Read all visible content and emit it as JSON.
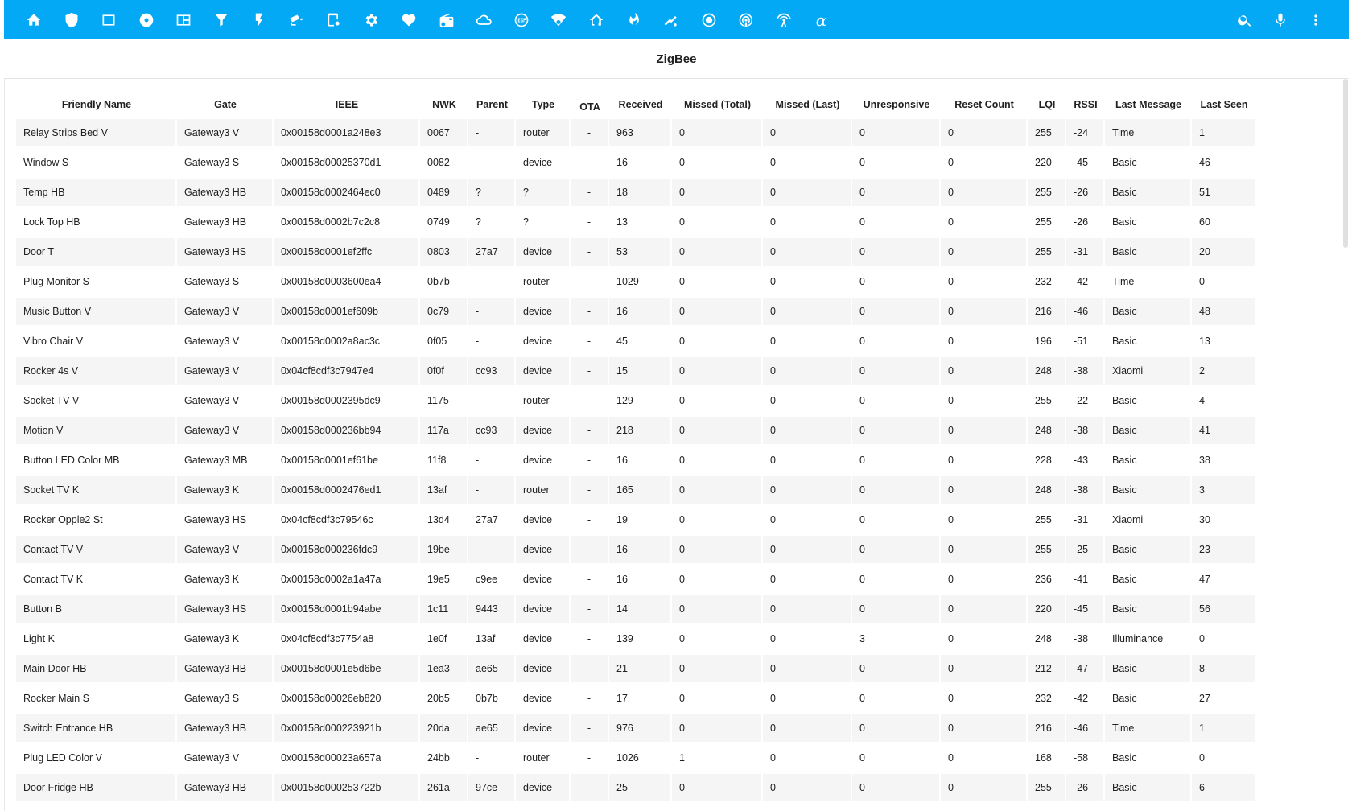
{
  "toolbar": {
    "color": "#03a9f4",
    "left_icons": [
      "home-icon",
      "shield-icon",
      "square-icon",
      "disc-icon",
      "panel-icon",
      "filter-icon",
      "flash-icon",
      "cctv-icon",
      "tablet-cog-icon",
      "gear-icon",
      "heart-pulse-icon",
      "radio-icon",
      "cloud-icon",
      "esp-chip-icon",
      "wifi-cog-icon",
      "home-thermometer-icon",
      "fire-icon",
      "sensor-icon",
      "record-icon",
      "podcast-icon",
      "antenna-icon",
      "alpha-icon"
    ],
    "alpha_glyph": "α",
    "right_icons": [
      "search-icon",
      "microphone-icon",
      "dots-vertical-icon"
    ]
  },
  "page": {
    "title": "ZigBee"
  },
  "table": {
    "columns": [
      "Friendly Name",
      "Gate",
      "IEEE",
      "NWK",
      "Parent",
      "Type",
      "OTA",
      "Received",
      "Missed (Total)",
      "Missed (Last)",
      "Unresponsive",
      "Reset Count",
      "LQI",
      "RSSI",
      "Last Message",
      "Last Seen"
    ],
    "rows": [
      [
        "Relay Strips Bed V",
        "Gateway3 V",
        "0x00158d0001a248e3",
        "0067",
        "-",
        "router",
        "-",
        "963",
        "0",
        "0",
        "0",
        "0",
        "255",
        "-24",
        "Time",
        "1"
      ],
      [
        "Window S",
        "Gateway3 S",
        "0x00158d00025370d1",
        "0082",
        "-",
        "device",
        "-",
        "16",
        "0",
        "0",
        "0",
        "0",
        "220",
        "-45",
        "Basic",
        "46"
      ],
      [
        "Temp HB",
        "Gateway3 HB",
        "0x00158d0002464ec0",
        "0489",
        "?",
        "?",
        "-",
        "18",
        "0",
        "0",
        "0",
        "0",
        "255",
        "-26",
        "Basic",
        "51"
      ],
      [
        "Lock Top HB",
        "Gateway3 HB",
        "0x00158d0002b7c2c8",
        "0749",
        "?",
        "?",
        "-",
        "13",
        "0",
        "0",
        "0",
        "0",
        "255",
        "-26",
        "Basic",
        "60"
      ],
      [
        "Door T",
        "Gateway3 HS",
        "0x00158d0001ef2ffc",
        "0803",
        "27a7",
        "device",
        "-",
        "53",
        "0",
        "0",
        "0",
        "0",
        "255",
        "-31",
        "Basic",
        "20"
      ],
      [
        "Plug Monitor S",
        "Gateway3 S",
        "0x00158d0003600ea4",
        "0b7b",
        "-",
        "router",
        "-",
        "1029",
        "0",
        "0",
        "0",
        "0",
        "232",
        "-42",
        "Time",
        "0"
      ],
      [
        "Music Button V",
        "Gateway3 V",
        "0x00158d0001ef609b",
        "0c79",
        "-",
        "device",
        "-",
        "16",
        "0",
        "0",
        "0",
        "0",
        "216",
        "-46",
        "Basic",
        "48"
      ],
      [
        "Vibro Chair V",
        "Gateway3 V",
        "0x00158d0002a8ac3c",
        "0f05",
        "-",
        "device",
        "-",
        "45",
        "0",
        "0",
        "0",
        "0",
        "196",
        "-51",
        "Basic",
        "13"
      ],
      [
        "Rocker 4s V",
        "Gateway3 V",
        "0x04cf8cdf3c7947e4",
        "0f0f",
        "cc93",
        "device",
        "-",
        "15",
        "0",
        "0",
        "0",
        "0",
        "248",
        "-38",
        "Xiaomi",
        "2"
      ],
      [
        "Socket TV V",
        "Gateway3 V",
        "0x00158d0002395dc9",
        "1175",
        "-",
        "router",
        "-",
        "129",
        "0",
        "0",
        "0",
        "0",
        "255",
        "-22",
        "Basic",
        "4"
      ],
      [
        "Motion V",
        "Gateway3 V",
        "0x00158d000236bb94",
        "117a",
        "cc93",
        "device",
        "-",
        "218",
        "0",
        "0",
        "0",
        "0",
        "248",
        "-38",
        "Basic",
        "41"
      ],
      [
        "Button LED Color MB",
        "Gateway3 MB",
        "0x00158d0001ef61be",
        "11f8",
        "-",
        "device",
        "-",
        "16",
        "0",
        "0",
        "0",
        "0",
        "228",
        "-43",
        "Basic",
        "38"
      ],
      [
        "Socket TV K",
        "Gateway3 K",
        "0x00158d0002476ed1",
        "13af",
        "-",
        "router",
        "-",
        "165",
        "0",
        "0",
        "0",
        "0",
        "248",
        "-38",
        "Basic",
        "3"
      ],
      [
        "Rocker Opple2 St",
        "Gateway3 HS",
        "0x04cf8cdf3c79546c",
        "13d4",
        "27a7",
        "device",
        "-",
        "19",
        "0",
        "0",
        "0",
        "0",
        "255",
        "-31",
        "Xiaomi",
        "30"
      ],
      [
        "Contact TV V",
        "Gateway3 V",
        "0x00158d000236fdc9",
        "19be",
        "-",
        "device",
        "-",
        "16",
        "0",
        "0",
        "0",
        "0",
        "255",
        "-25",
        "Basic",
        "23"
      ],
      [
        "Contact TV K",
        "Gateway3 K",
        "0x00158d0002a1a47a",
        "19e5",
        "c9ee",
        "device",
        "-",
        "16",
        "0",
        "0",
        "0",
        "0",
        "236",
        "-41",
        "Basic",
        "47"
      ],
      [
        "Button B",
        "Gateway3 HS",
        "0x00158d0001b94abe",
        "1c11",
        "9443",
        "device",
        "-",
        "14",
        "0",
        "0",
        "0",
        "0",
        "220",
        "-45",
        "Basic",
        "56"
      ],
      [
        "Light K",
        "Gateway3 K",
        "0x04cf8cdf3c7754a8",
        "1e0f",
        "13af",
        "device",
        "-",
        "139",
        "0",
        "0",
        "3",
        "0",
        "248",
        "-38",
        "Illuminance",
        "0"
      ],
      [
        "Main Door HB",
        "Gateway3 HB",
        "0x00158d0001e5d6be",
        "1ea3",
        "ae65",
        "device",
        "-",
        "21",
        "0",
        "0",
        "0",
        "0",
        "212",
        "-47",
        "Basic",
        "8"
      ],
      [
        "Rocker Main S",
        "Gateway3 S",
        "0x00158d00026eb820",
        "20b5",
        "0b7b",
        "device",
        "-",
        "17",
        "0",
        "0",
        "0",
        "0",
        "232",
        "-42",
        "Basic",
        "27"
      ],
      [
        "Switch Entrance HB",
        "Gateway3 HB",
        "0x00158d000223921b",
        "20da",
        "ae65",
        "device",
        "-",
        "976",
        "0",
        "0",
        "0",
        "0",
        "216",
        "-46",
        "Time",
        "1"
      ],
      [
        "Plug LED Color V",
        "Gateway3 V",
        "0x00158d00023a657a",
        "24bb",
        "-",
        "router",
        "-",
        "1026",
        "1",
        "0",
        "0",
        "0",
        "168",
        "-58",
        "Basic",
        "0"
      ],
      [
        "Door Fridge HB",
        "Gateway3 HB",
        "0x00158d000253722b",
        "261a",
        "97ce",
        "device",
        "-",
        "25",
        "0",
        "0",
        "0",
        "0",
        "255",
        "-26",
        "Basic",
        "6"
      ]
    ]
  }
}
